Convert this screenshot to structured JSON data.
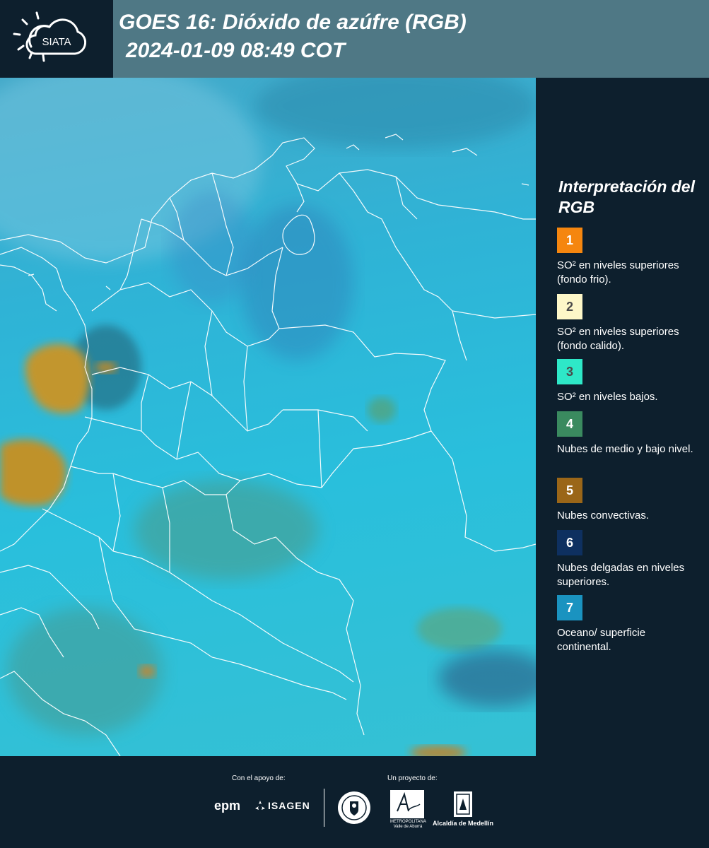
{
  "header": {
    "logo_text": "SIATA",
    "title": "GOES 16: Dióxido de azúfre (RGB)",
    "datetime": "2024-01-09 08:49 COT"
  },
  "legend": {
    "title": "Interpretación del RGB",
    "items": [
      {
        "number": "1",
        "color": "#f5860f",
        "text_color": "#ffffff",
        "label": "SO² en niveles superiores (fondo frio)."
      },
      {
        "number": "2",
        "color": "#fdf7c8",
        "text_color": "#4a4a4a",
        "label": "SO² en niveles superiores (fondo calido)."
      },
      {
        "number": "3",
        "color": "#2ee8c8",
        "text_color": "#4a4a4a",
        "label": "SO² en niveles bajos."
      },
      {
        "number": "4",
        "color": "#3a8a5f",
        "text_color": "#ffffff",
        "label": "Nubes de medio y bajo nivel."
      },
      {
        "number": "5",
        "color": "#9a6618",
        "text_color": "#ffffff",
        "label": "Nubes convectivas."
      },
      {
        "number": "6",
        "color": "#0e3060",
        "text_color": "#ffffff",
        "label": "Nubes delgadas en niveles superiores."
      },
      {
        "number": "7",
        "color": "#1a93c0",
        "text_color": "#ffffff",
        "label": "Oceano/ superficie continental."
      }
    ]
  },
  "footer": {
    "support_label": "Con el apoyo de:",
    "project_label": "Un proyecto de:",
    "sponsors": [
      "epm",
      "ISAGEN"
    ],
    "partners": [
      "METROPOLITANA Valle de Aburrá",
      "Alcaldía de Medellín"
    ]
  }
}
